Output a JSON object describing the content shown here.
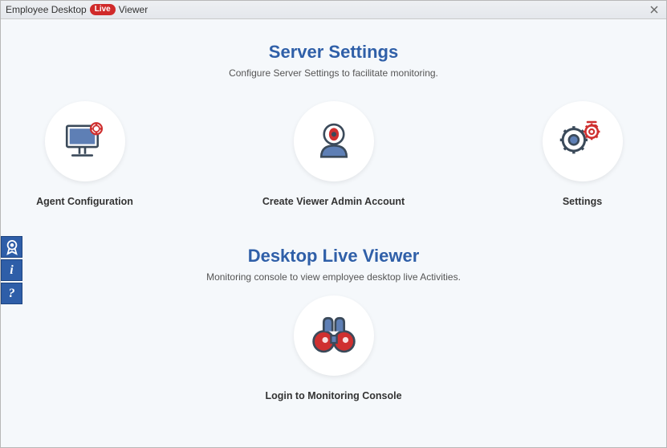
{
  "window": {
    "title_prefix": "Employee Desktop",
    "title_badge": "Live",
    "title_suffix": "Viewer"
  },
  "section1": {
    "title": "Server Settings",
    "subtitle": "Configure Server Settings to facilitate monitoring.",
    "cards": [
      {
        "label": "Agent Configuration"
      },
      {
        "label": "Create Viewer Admin Account"
      },
      {
        "label": "Settings"
      }
    ]
  },
  "section2": {
    "title": "Desktop Live Viewer",
    "subtitle": "Monitoring console to view employee desktop live Activities.",
    "cards": [
      {
        "label": "Login to Monitoring Console"
      }
    ]
  },
  "siderail": {
    "info_char": "i",
    "help_char": "?"
  }
}
